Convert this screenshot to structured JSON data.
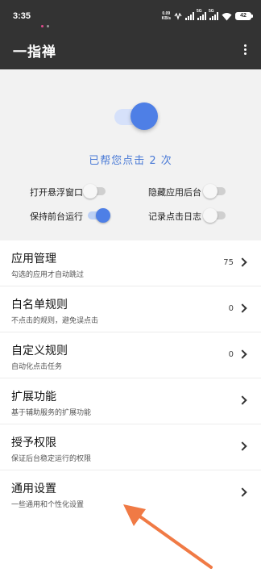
{
  "status_bar": {
    "time": "3:35",
    "net_speed_value": "0.09",
    "net_speed_unit": "KB/s",
    "signal_tag_1": "5G",
    "signal_tag_2": "5G",
    "battery": "42"
  },
  "app_bar": {
    "title": "一指禅",
    "overflow_icon": "more-vert-icon"
  },
  "hero": {
    "switch_on": true,
    "status_text": "已帮您点击 2 次"
  },
  "options": [
    {
      "label": "打开悬浮窗口",
      "on": false
    },
    {
      "label": "隐藏应用后台",
      "on": false
    },
    {
      "label": "保持前台运行",
      "on": true
    },
    {
      "label": "记录点击日志",
      "on": false
    }
  ],
  "menu": [
    {
      "title": "应用管理",
      "subtitle": "勾选的应用才自动跳过",
      "count": "75"
    },
    {
      "title": "白名单规则",
      "subtitle": "不点击的规则，避免误点击",
      "count": "0"
    },
    {
      "title": "自定义规则",
      "subtitle": "自动化点击任务",
      "count": "0"
    },
    {
      "title": "扩展功能",
      "subtitle": "基于辅助服务的扩展功能",
      "count": ""
    },
    {
      "title": "授予权限",
      "subtitle": "保证后台稳定运行的权限",
      "count": ""
    },
    {
      "title": "通用设置",
      "subtitle": "一些通用和个性化设置",
      "count": ""
    }
  ],
  "colors": {
    "app_bar": "#333333",
    "accent": "#4e7fe6",
    "annotation_arrow": "#f07a45"
  }
}
